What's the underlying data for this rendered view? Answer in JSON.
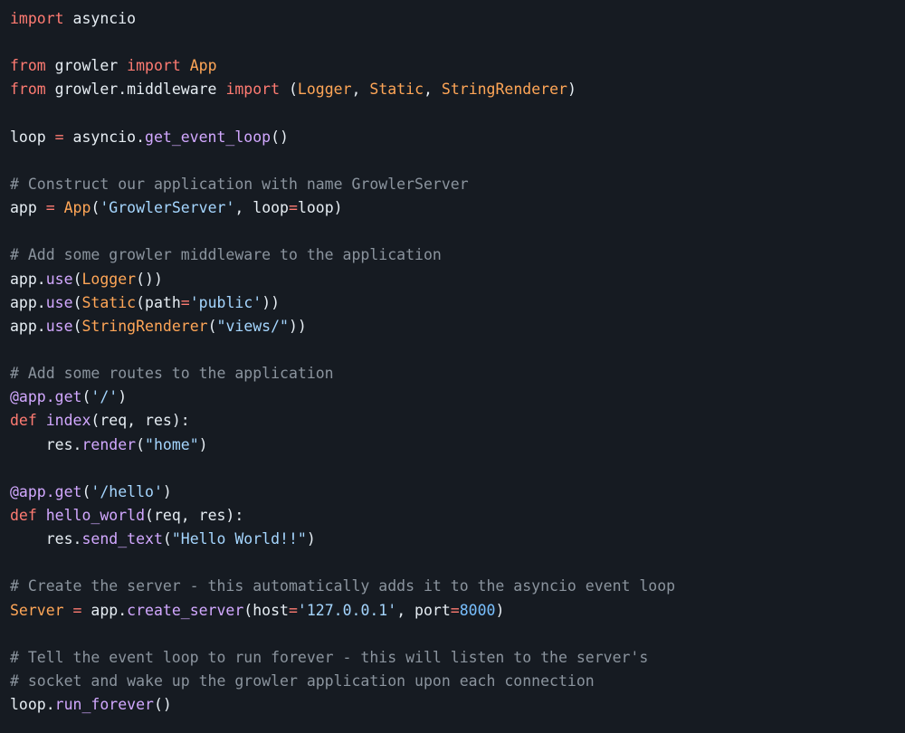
{
  "editor": {
    "theme": {
      "background": "#161b22",
      "text": "#e6edf3",
      "keyword": "#ff7b72",
      "class": "#ffa657",
      "function": "#d2a8ff",
      "string": "#a5d6ff",
      "number": "#79c0ff",
      "comment": "#8b949e"
    },
    "lines": [
      [
        [
          "keyword",
          "import"
        ],
        [
          "text",
          " asyncio"
        ]
      ],
      [],
      [
        [
          "keyword",
          "from"
        ],
        [
          "text",
          " growler "
        ],
        [
          "keyword",
          "import"
        ],
        [
          "text",
          " "
        ],
        [
          "class",
          "App"
        ]
      ],
      [
        [
          "keyword",
          "from"
        ],
        [
          "text",
          " growler.middleware "
        ],
        [
          "keyword",
          "import"
        ],
        [
          "text",
          " ("
        ],
        [
          "class",
          "Logger"
        ],
        [
          "text",
          ", "
        ],
        [
          "class",
          "Static"
        ],
        [
          "text",
          ", "
        ],
        [
          "class",
          "StringRenderer"
        ],
        [
          "text",
          ")"
        ]
      ],
      [],
      [
        [
          "text",
          "loop "
        ],
        [
          "operator",
          "="
        ],
        [
          "text",
          " asyncio."
        ],
        [
          "func",
          "get_event_loop"
        ],
        [
          "text",
          "()"
        ]
      ],
      [],
      [
        [
          "comment",
          "# Construct our application with name GrowlerServer"
        ]
      ],
      [
        [
          "text",
          "app "
        ],
        [
          "operator",
          "="
        ],
        [
          "text",
          " "
        ],
        [
          "class",
          "App"
        ],
        [
          "text",
          "("
        ],
        [
          "string",
          "'GrowlerServer'"
        ],
        [
          "text",
          ", loop"
        ],
        [
          "operator",
          "="
        ],
        [
          "text",
          "loop)"
        ]
      ],
      [],
      [
        [
          "comment",
          "# Add some growler middleware to the application"
        ]
      ],
      [
        [
          "text",
          "app."
        ],
        [
          "func",
          "use"
        ],
        [
          "text",
          "("
        ],
        [
          "class",
          "Logger"
        ],
        [
          "text",
          "())"
        ]
      ],
      [
        [
          "text",
          "app."
        ],
        [
          "func",
          "use"
        ],
        [
          "text",
          "("
        ],
        [
          "class",
          "Static"
        ],
        [
          "text",
          "(path"
        ],
        [
          "operator",
          "="
        ],
        [
          "string",
          "'public'"
        ],
        [
          "text",
          "))"
        ]
      ],
      [
        [
          "text",
          "app."
        ],
        [
          "func",
          "use"
        ],
        [
          "text",
          "("
        ],
        [
          "class",
          "StringRenderer"
        ],
        [
          "text",
          "("
        ],
        [
          "string",
          "\"views/\""
        ],
        [
          "text",
          "))"
        ]
      ],
      [],
      [
        [
          "comment",
          "# Add some routes to the application"
        ]
      ],
      [
        [
          "func",
          "@app.get"
        ],
        [
          "text",
          "("
        ],
        [
          "string",
          "'/'"
        ],
        [
          "text",
          ")"
        ]
      ],
      [
        [
          "keyword",
          "def"
        ],
        [
          "text",
          " "
        ],
        [
          "func",
          "index"
        ],
        [
          "text",
          "(req, res):"
        ]
      ],
      [
        [
          "text",
          "    res."
        ],
        [
          "func",
          "render"
        ],
        [
          "text",
          "("
        ],
        [
          "string",
          "\"home\""
        ],
        [
          "text",
          ")"
        ]
      ],
      [],
      [
        [
          "func",
          "@app.get"
        ],
        [
          "text",
          "("
        ],
        [
          "string",
          "'/hello'"
        ],
        [
          "text",
          ")"
        ]
      ],
      [
        [
          "keyword",
          "def"
        ],
        [
          "text",
          " "
        ],
        [
          "func",
          "hello_world"
        ],
        [
          "text",
          "(req, res):"
        ]
      ],
      [
        [
          "text",
          "    res."
        ],
        [
          "func",
          "send_text"
        ],
        [
          "text",
          "("
        ],
        [
          "string",
          "\"Hello World!!\""
        ],
        [
          "text",
          ")"
        ]
      ],
      [],
      [
        [
          "comment",
          "# Create the server - this automatically adds it to the asyncio event loop"
        ]
      ],
      [
        [
          "class",
          "Server"
        ],
        [
          "text",
          " "
        ],
        [
          "operator",
          "="
        ],
        [
          "text",
          " app."
        ],
        [
          "func",
          "create_server"
        ],
        [
          "text",
          "(host"
        ],
        [
          "operator",
          "="
        ],
        [
          "string",
          "'127.0.0.1'"
        ],
        [
          "text",
          ", port"
        ],
        [
          "operator",
          "="
        ],
        [
          "number",
          "8000"
        ],
        [
          "text",
          ")"
        ]
      ],
      [],
      [
        [
          "comment",
          "# Tell the event loop to run forever - this will listen to the server's"
        ]
      ],
      [
        [
          "comment",
          "# socket and wake up the growler application upon each connection"
        ]
      ],
      [
        [
          "text",
          "loop."
        ],
        [
          "func",
          "run_forever"
        ],
        [
          "text",
          "()"
        ]
      ]
    ]
  }
}
